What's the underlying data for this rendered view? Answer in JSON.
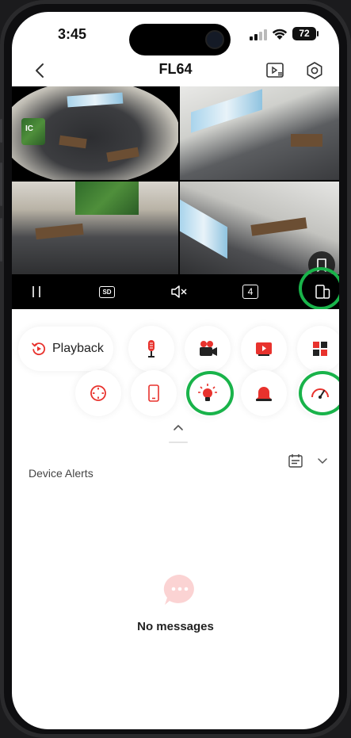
{
  "status_bar": {
    "time": "3:45",
    "battery": "72"
  },
  "nav": {
    "title": "FL64"
  },
  "video": {
    "logo_text": "IC",
    "ctrl_sd": "SD",
    "ctrl_split": "4"
  },
  "actions": {
    "playback_label": "Playback"
  },
  "alerts": {
    "title": "Device Alerts",
    "empty_text": "No messages"
  },
  "colors": {
    "accent": "#e8322d",
    "highlight": "#19b34a",
    "pink": "#fbd3d3"
  }
}
